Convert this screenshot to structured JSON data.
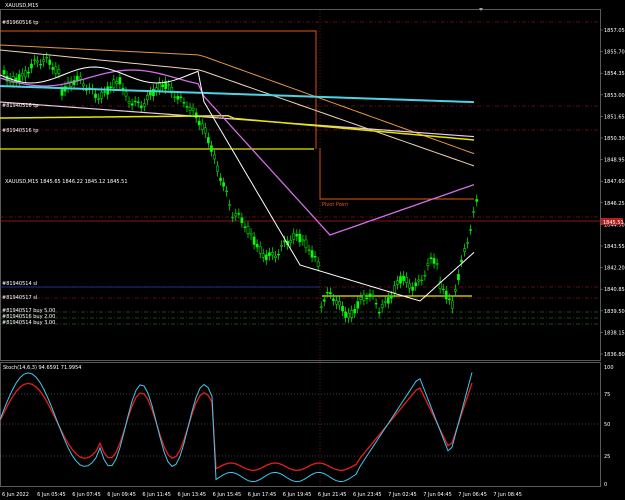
{
  "window": {
    "title": "XAUUSD,M15",
    "icon": "chart-window-icon"
  },
  "header": {
    "symbol_line": "XAUUSD,M15  1845.65 1846.22 1845.12 1845.51"
  },
  "orders": {
    "top_left": "#81960516 tp",
    "tp2": "#81940516 tp",
    "tp3": "#81940516 tp",
    "sl1": "#81940514 sl",
    "sl2": "#81940517 sl",
    "buy1": "#81940517 buy 5.00",
    "buy2": "#81940516 buy 2.00",
    "buy3": "#81940514 buy 3.00"
  },
  "pivot_label": "Pivot Point",
  "price_axis": {
    "labels": [
      "1857.05",
      "1855.70",
      "1854.35",
      "1853.00",
      "1851.65",
      "1850.30",
      "1848.95",
      "1847.60",
      "1846.25",
      "1844.90",
      "1843.55",
      "1842.20",
      "1840.85",
      "1839.50",
      "1838.15",
      "1836.80"
    ],
    "current_price": "1845.51"
  },
  "stoch": {
    "label": "Stoch(14,6,3) 94.6591 71.9954",
    "levels": [
      "100",
      "75",
      "50",
      "25",
      "0"
    ]
  },
  "time_axis": [
    "6 Jun 2022",
    "6 Jun 05:45",
    "6 Jun 07:45",
    "6 Jun 09:45",
    "6 Jun 11:45",
    "6 Jun 13:45",
    "6 Jun 15:45",
    "6 Jun 17:45",
    "6 Jun 19:45",
    "6 Jun 21:45",
    "6 Jun 23:45",
    "7 Jun 02:45",
    "7 Jun 04:45",
    "7 Jun 06:45",
    "7 Jun 08:45"
  ],
  "colors": {
    "background": "#000000",
    "candle": "#00ff00",
    "ma_cyan": "#4dd2e6",
    "ma_yellow": "#e6e600",
    "ma_magenta": "#d26ee6",
    "ma_white": "#ffffff",
    "ma_orange": "#e69640",
    "stoch_main": "#40c8f0",
    "stoch_signal": "#e61e1e",
    "pivot": "#e65a14",
    "order_line": "#b41e1e"
  }
}
